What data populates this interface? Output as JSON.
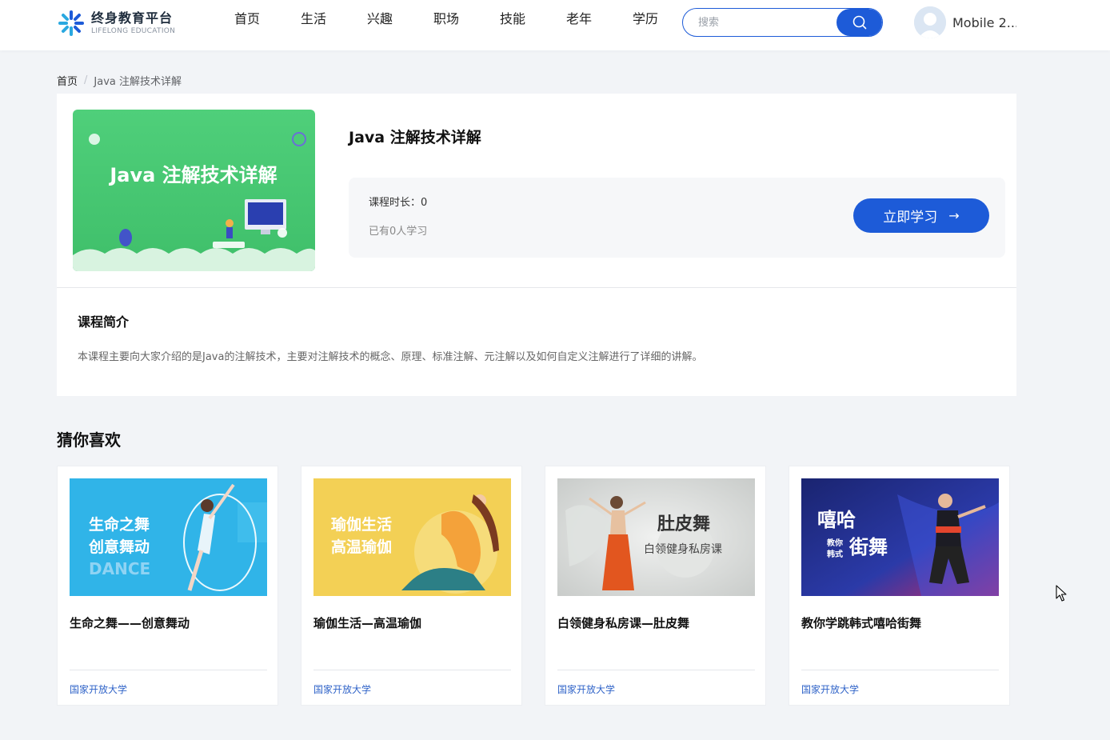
{
  "brand": {
    "title": "终身教育平台",
    "subtitle": "LIFELONG EDUCATION",
    "accent": "#1d5bd8"
  },
  "nav": {
    "items": [
      "首页",
      "生活",
      "兴趣",
      "职场",
      "技能",
      "老年",
      "学历"
    ]
  },
  "search": {
    "placeholder": "搜索",
    "icon": "search-icon"
  },
  "user": {
    "name": "Mobile 2..."
  },
  "breadcrumb": {
    "home": "首页",
    "separator": "/",
    "current": "Java 注解技术详解"
  },
  "course": {
    "title": "Java 注解技术详解",
    "cover_text": "Java 注解技术详解",
    "duration": "课程时长：0",
    "learners": "已有0人学习",
    "study_button": "立即学习",
    "study_arrow": "→",
    "intro_heading": "课程简介",
    "intro_text": "本课程主要向大家介绍的是Java的注解技术，主要对注解技术的概念、原理、标准注解、元注解以及如何自定义注解进行了详细的讲解。"
  },
  "recommend": {
    "heading": "猜你喜欢",
    "items": [
      {
        "name": "生命之舞——创意舞动",
        "org": "国家开放大学",
        "thumb_line1": "生命之舞",
        "thumb_line2": "创意舞动",
        "thumb_line3": "DANCE"
      },
      {
        "name": "瑜伽生活—高温瑜伽",
        "org": "国家开放大学",
        "thumb_line1": "瑜伽生活",
        "thumb_line2": "高温瑜伽"
      },
      {
        "name": "白领健身私房课—肚皮舞",
        "org": "国家开放大学",
        "thumb_line1": "肚皮舞",
        "thumb_line2": "白领健身私房课"
      },
      {
        "name": "教你学跳韩式嘻哈街舞",
        "org": "国家开放大学",
        "thumb_line1": "嘻哈",
        "thumb_line2": "教你",
        "thumb_line3": "韩式",
        "thumb_line4": "街舞"
      }
    ]
  }
}
